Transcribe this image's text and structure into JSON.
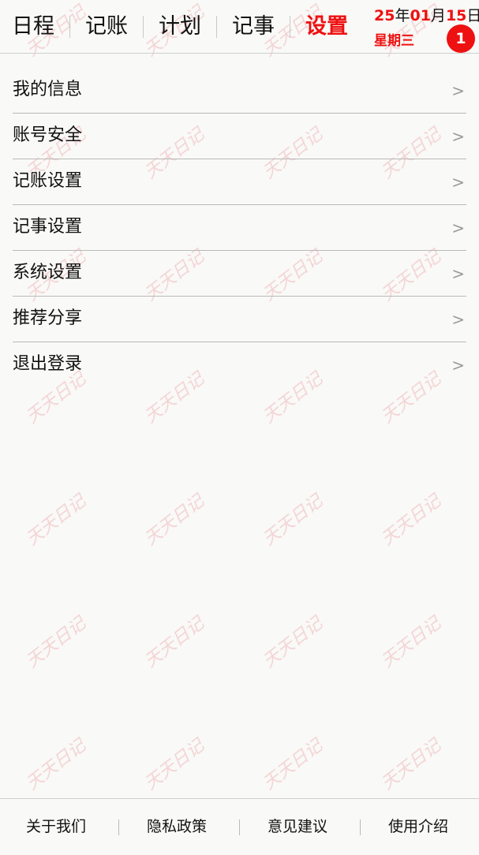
{
  "header": {
    "tabs": [
      {
        "label": "日程"
      },
      {
        "label": "记账"
      },
      {
        "label": "计划"
      },
      {
        "label": "记事"
      },
      {
        "label": "设置"
      }
    ],
    "active_tab": "设置",
    "date": {
      "year": "25",
      "year_unit": "年",
      "month": "01",
      "month_unit": "月",
      "day": "15",
      "day_unit": "日",
      "weekday": "星期三"
    },
    "notification_count": "1"
  },
  "menu": {
    "items": [
      {
        "label": "我的信息",
        "arrow": ">"
      },
      {
        "label": "账号安全",
        "arrow": ">"
      },
      {
        "label": "记账设置",
        "arrow": ">"
      },
      {
        "label": "记事设置",
        "arrow": ">"
      },
      {
        "label": "系统设置",
        "arrow": ">"
      },
      {
        "label": "推荐分享",
        "arrow": ">"
      },
      {
        "label": "退出登录",
        "arrow": ">"
      }
    ]
  },
  "footer": {
    "links": [
      {
        "label": "关于我们"
      },
      {
        "label": "隐私政策"
      },
      {
        "label": "意见建议"
      },
      {
        "label": "使用介绍"
      }
    ]
  },
  "watermark": {
    "text": "天天日记"
  },
  "colors": {
    "accent": "#ee1111",
    "background": "#f9f9f7",
    "watermark": "#f2caca"
  }
}
